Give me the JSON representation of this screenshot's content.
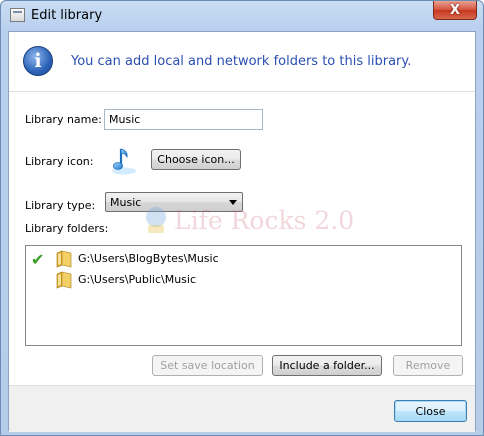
{
  "window": {
    "title": "Edit library",
    "close_glyph": "X"
  },
  "info": {
    "icon_glyph": "i",
    "text": "You can add local and network folders to this library."
  },
  "library_name": {
    "label": "Library name:",
    "value": "Music"
  },
  "library_icon": {
    "label": "Library icon:",
    "icon": "music-note-icon",
    "button": "Choose icon..."
  },
  "library_type": {
    "label": "Library type:",
    "selected": "Music"
  },
  "watermark": {
    "text": "Life Rocks 2.0"
  },
  "library_folders": {
    "label": "Library folders:",
    "items": [
      {
        "path": "G:\\Users\\BlogBytes\\Music",
        "save_location": true
      },
      {
        "path": "G:\\Users\\Public\\Music",
        "save_location": false
      }
    ],
    "check_glyph": "✔"
  },
  "buttons": {
    "set_save_location": "Set save location",
    "include_folder": "Include a folder...",
    "remove": "Remove",
    "close": "Close"
  },
  "colors": {
    "info_text": "#2b4fb0",
    "check": "#3a9d23",
    "titlebar": "#b8cfee",
    "close_button": "#c6361e"
  }
}
